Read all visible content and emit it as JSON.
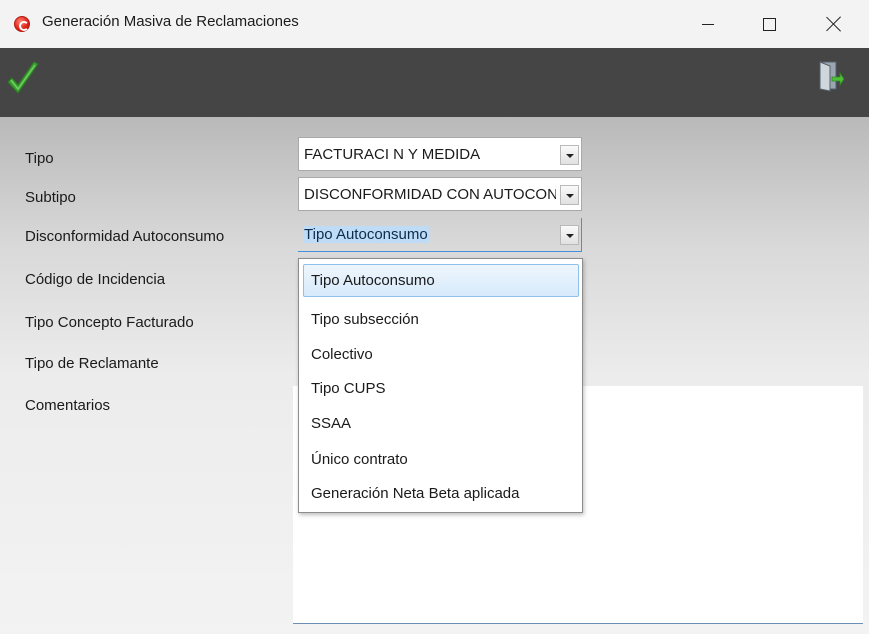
{
  "window": {
    "title": "Generación Masiva de Reclamaciones"
  },
  "toolbar": {
    "ok_icon": "checkmark-icon",
    "exit_icon": "exit-door-icon"
  },
  "form": {
    "labels": {
      "tipo": "Tipo",
      "subtipo": "Subtipo",
      "disconformidad": "Disconformidad Autoconsumo",
      "codigo": "Código de Incidencia",
      "concepto": "Tipo Concepto Facturado",
      "reclamante": "Tipo de Reclamante",
      "comentarios": "Comentarios"
    },
    "tipo_value": "FACTURACI N Y MEDIDA",
    "subtipo_value": "DISCONFORMIDAD CON AUTOCONSUMO",
    "disconformidad_value": "Tipo Autoconsumo"
  },
  "dropdown": {
    "options": [
      "Tipo Autoconsumo",
      "Tipo subsección",
      "Colectivo",
      "Tipo CUPS",
      "SSAA",
      "Único contrato",
      "Generación Neta Beta aplicada"
    ],
    "highlighted": "Tipo Autoconsumo"
  },
  "colors": {
    "toolbar_bg": "#454545",
    "check_green": "#3aa12f",
    "accent_blue": "#4a90d9"
  }
}
